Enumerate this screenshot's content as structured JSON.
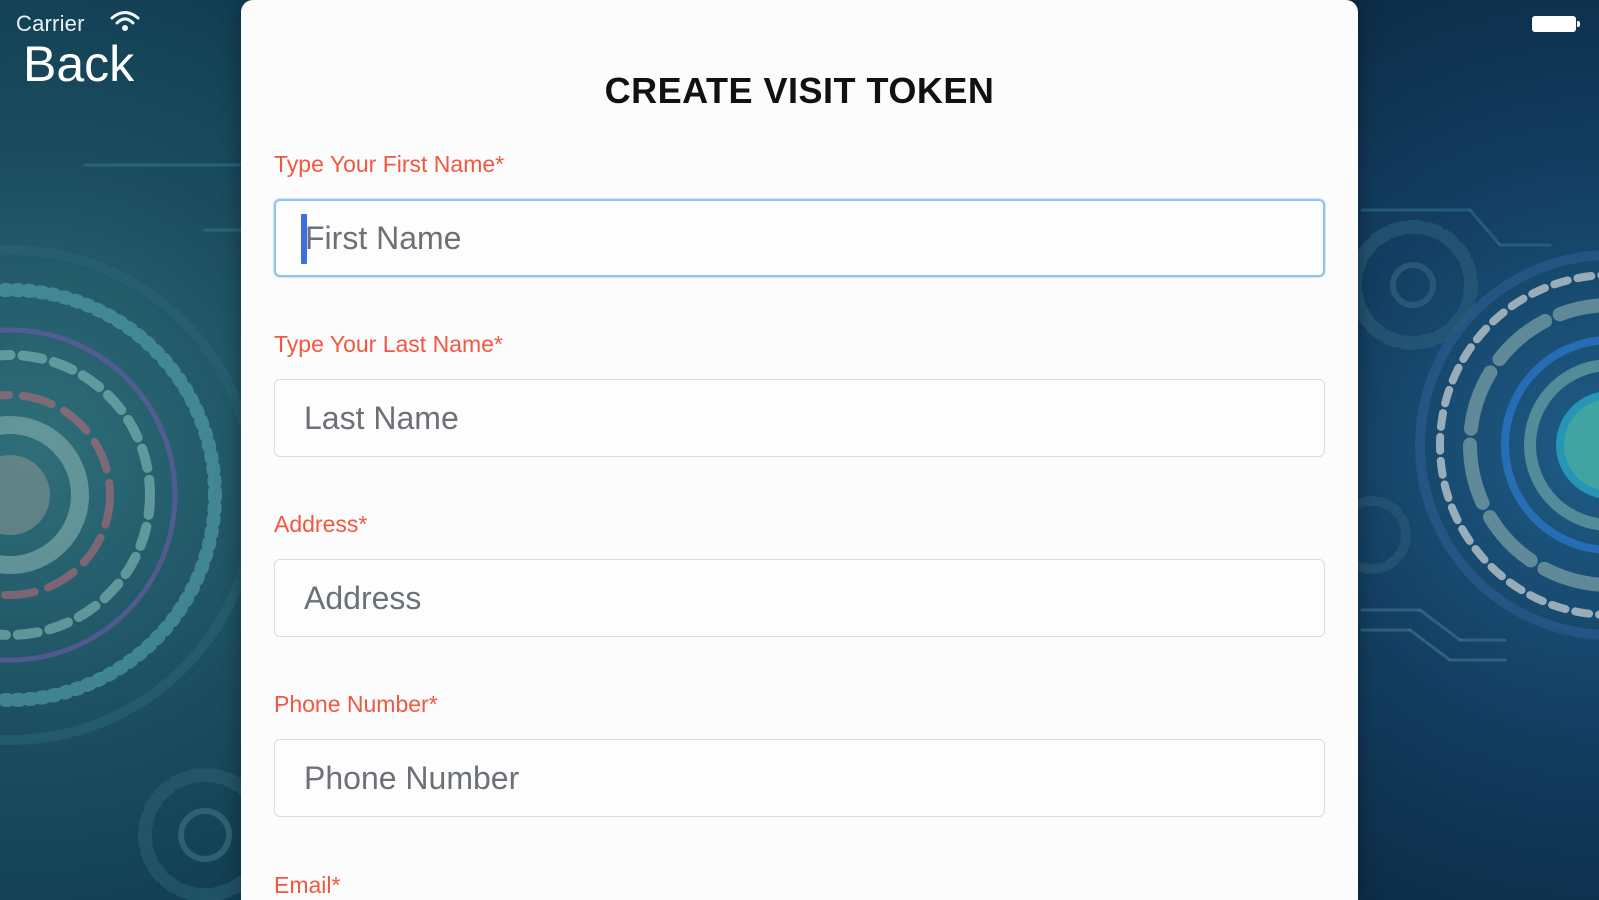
{
  "status_bar": {
    "carrier": "Carrier"
  },
  "nav": {
    "back_label": "Back"
  },
  "form": {
    "title": "CREATE VISIT TOKEN",
    "fields": [
      {
        "label": "Type Your First Name*",
        "placeholder": "First Name",
        "value": "",
        "focused": true
      },
      {
        "label": "Type Your Last Name*",
        "placeholder": "Last Name",
        "value": ""
      },
      {
        "label": "Address*",
        "placeholder": "Address",
        "value": ""
      },
      {
        "label": "Phone Number*",
        "placeholder": "Phone Number",
        "value": ""
      },
      {
        "label": "Email*"
      }
    ]
  },
  "colors": {
    "label": "#f2573f",
    "focus_border": "#8ec3f5",
    "caret": "#3c6fe0",
    "background": "#0b2f45"
  }
}
